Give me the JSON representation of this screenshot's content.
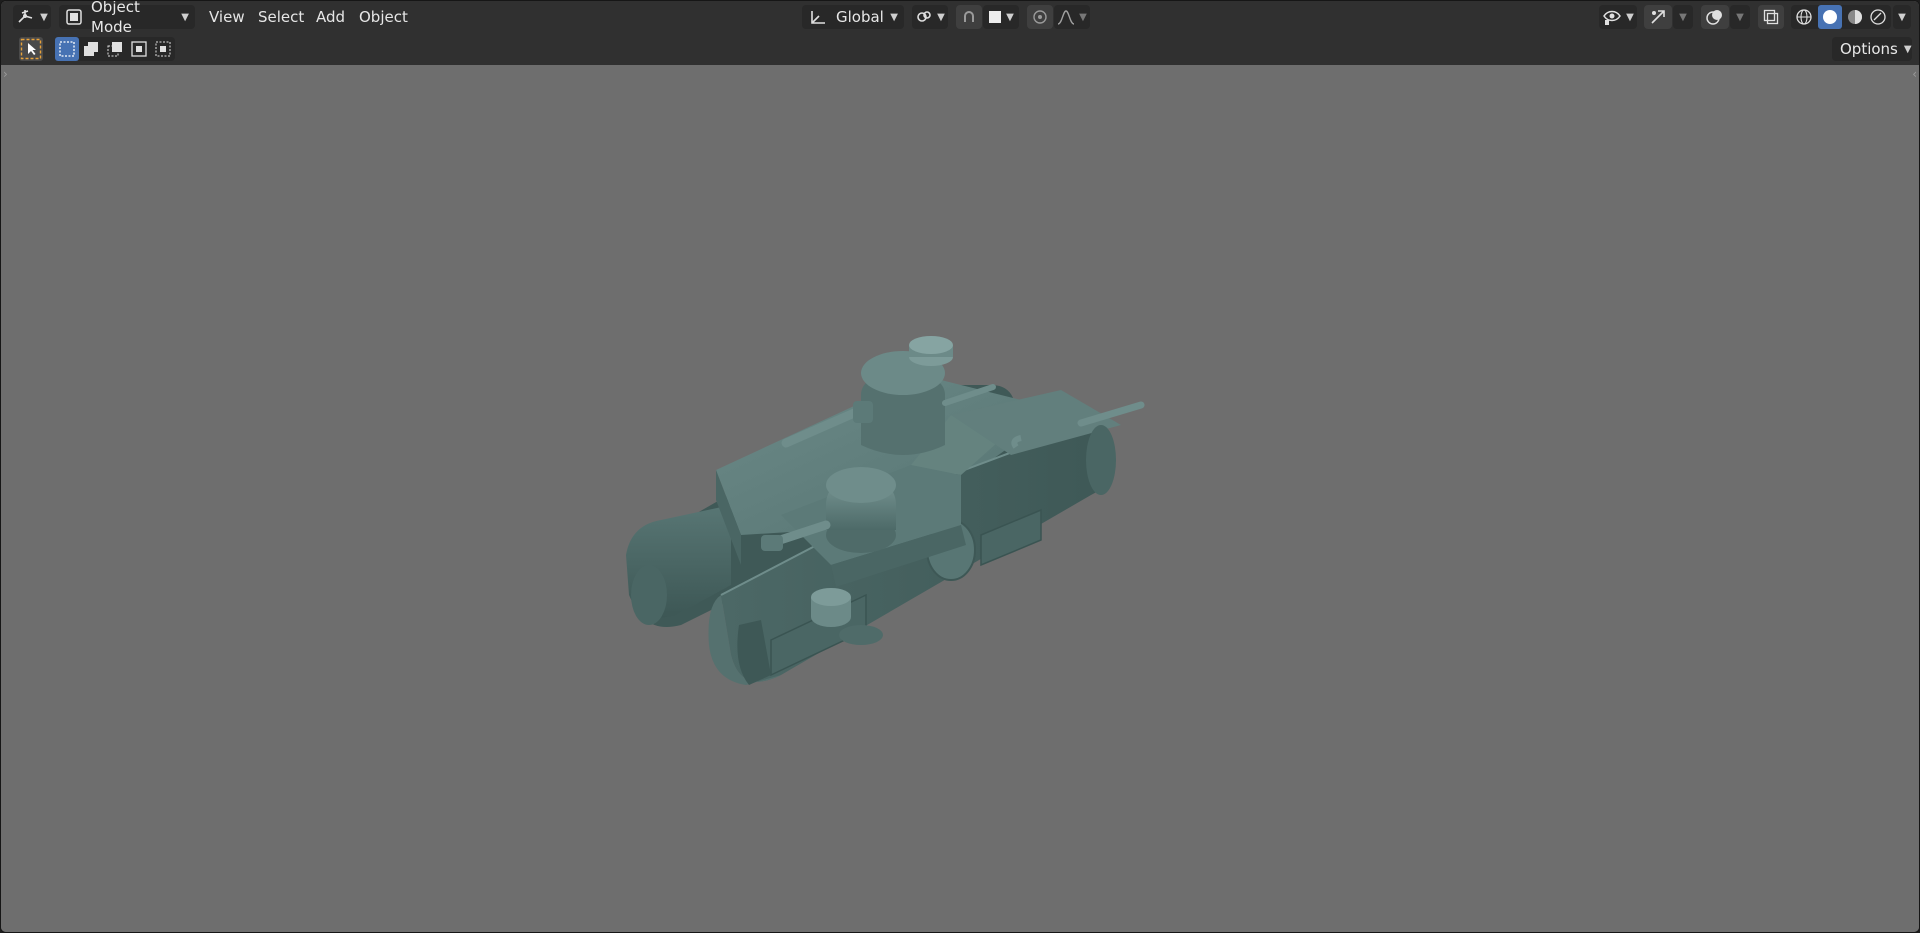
{
  "header": {
    "editor_type_icon": "3d-viewport-icon",
    "mode_label": "Object Mode",
    "menus": [
      "View",
      "Select",
      "Add",
      "Object"
    ],
    "transform_orientation": "Global",
    "pivot_icon": "pivot-point-icon",
    "snap_icon": "magnet-snap-icon",
    "snap_target_icon": "snap-target-icon",
    "proportional_icon": "proportional-editing-icon",
    "falloff_icon": "falloff-curve-icon",
    "visibility_icon": "object-visibility-icon",
    "gizmo_icon": "gizmo-icon",
    "overlay_icon": "overlays-icon",
    "xray_icon": "xray-icon",
    "shading_modes": [
      "wireframe-shading-icon",
      "solid-shading-icon",
      "material-preview-icon",
      "rendered-shading-icon"
    ],
    "active_shading": "solid-shading-icon"
  },
  "toolbar": {
    "select_tool_icon": "select-box-tool-icon",
    "selection_modes": [
      "set-new-selection-icon",
      "extend-selection-icon",
      "subtract-selection-icon",
      "invert-selection-icon",
      "intersect-selection-icon"
    ],
    "options_label": "Options"
  },
  "viewport": {
    "background": "#6e6e6e",
    "model_color": "#4f6b6a",
    "model_name": "tank-model"
  }
}
